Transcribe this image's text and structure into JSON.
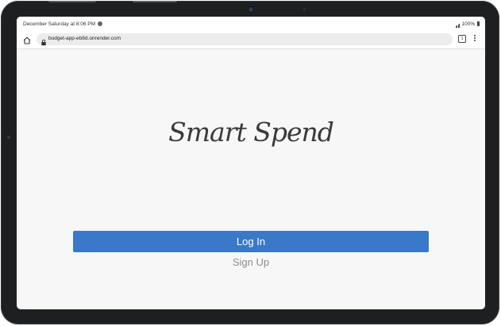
{
  "status_bar": {
    "datetime": "December Saturday at 8:06 PM",
    "battery": "100%"
  },
  "browser": {
    "url": "budget-app-eb8d.onrender.com",
    "tab_count": "1"
  },
  "app": {
    "logo_text": "Smart Spend",
    "login_label": "Log In",
    "signup_label": "Sign Up",
    "colors": {
      "primary": "#3a78c8",
      "background": "#f7f7f7",
      "muted_link": "#8c8c8c"
    }
  },
  "icons": [
    "home-icon",
    "lock-icon",
    "tabs-icon",
    "menu-icon",
    "signal-icon",
    "battery-icon",
    "dnd-icon"
  ]
}
